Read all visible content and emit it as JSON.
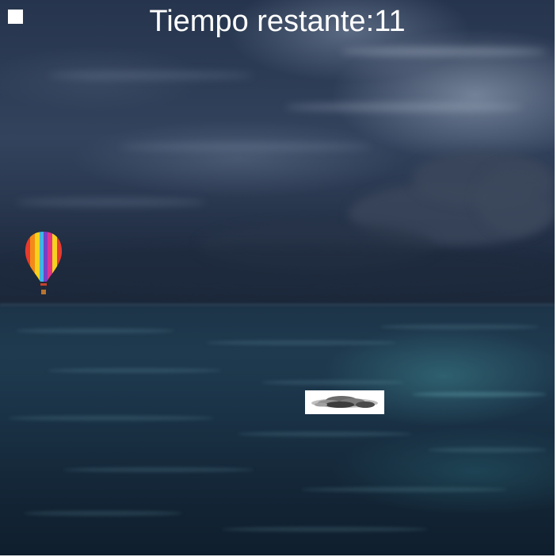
{
  "hud": {
    "timer_label": "Tiempo restante:",
    "timer_value": "11"
  },
  "sprites": {
    "player": "hot-air-balloon-icon",
    "obstacle": "storm-cloud-icon"
  },
  "colors": {
    "sky": "#2d3c55",
    "sea": "#1a3246",
    "text": "#ffffff"
  }
}
